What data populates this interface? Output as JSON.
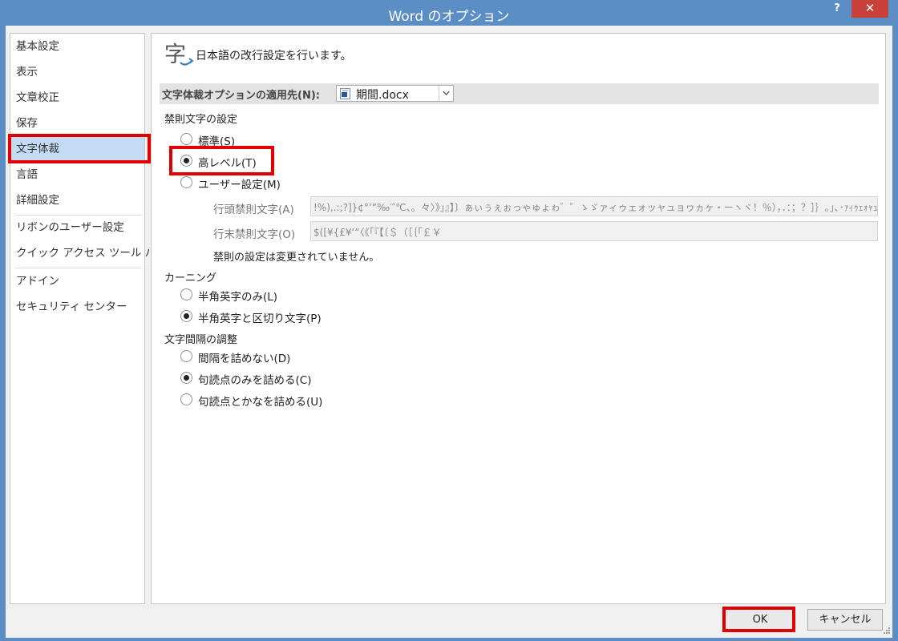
{
  "window": {
    "title": "Word のオプション",
    "help_label": "?",
    "close_label": "✕"
  },
  "nav": {
    "items": [
      {
        "label": "基本設定"
      },
      {
        "label": "表示"
      },
      {
        "label": "文章校正"
      },
      {
        "label": "保存"
      },
      {
        "label": "文字体裁",
        "selected": true
      },
      {
        "label": "言語"
      },
      {
        "label": "詳細設定"
      },
      {
        "label": "リボンのユーザー設定"
      },
      {
        "label": "クイック アクセス ツール バー"
      },
      {
        "label": "アドイン"
      },
      {
        "label": "セキュリティ センター"
      }
    ]
  },
  "header": {
    "icon": "typography-icon",
    "text": "日本語の改行設定を行います。"
  },
  "apply": {
    "label": "文字体裁オプションの適用先(N):",
    "document": "期間.docx"
  },
  "kinsoku": {
    "title": "禁則文字の設定",
    "options": [
      {
        "label": "標準(S)",
        "checked": false
      },
      {
        "label": "高レベル(T)",
        "checked": true
      },
      {
        "label": "ユーザー設定(M)",
        "checked": false
      }
    ],
    "leading_label": "行頭禁則文字(A)",
    "leading_value": "!%),.:;?]}¢°’”‰′″℃、。々〉》」』】〕ぁぃぅぇぉっゃゅょゎ゛゜ゝゞァィゥェォッャュョヮヵヶ・ーヽヾ！％），．：；？］｝｡｣､･ｧｨｩｪｫｬｭｮｯｰﾞﾟ",
    "trailing_label": "行末禁則文字(O)",
    "trailing_value": "$([¥{£¥‘“〈《「『【〔＄（［｛｢￡￥",
    "note": "禁則の設定は変更されていません。"
  },
  "kerning": {
    "title": "カーニング",
    "options": [
      {
        "label": "半角英字のみ(L)",
        "checked": false
      },
      {
        "label": "半角英字と区切り文字(P)",
        "checked": true
      }
    ]
  },
  "spacing": {
    "title": "文字間隔の調整",
    "options": [
      {
        "label": "間隔を詰めない(D)",
        "checked": false
      },
      {
        "label": "句読点のみを詰める(C)",
        "checked": true
      },
      {
        "label": "句読点とかなを詰める(U)",
        "checked": false
      }
    ]
  },
  "buttons": {
    "ok": "OK",
    "cancel": "キャンセル"
  },
  "colors": {
    "titlebar": "#5b8ec5",
    "selected_nav": "#c5dbf4",
    "highlight": "#e00000",
    "close_button": "#c7403a"
  }
}
